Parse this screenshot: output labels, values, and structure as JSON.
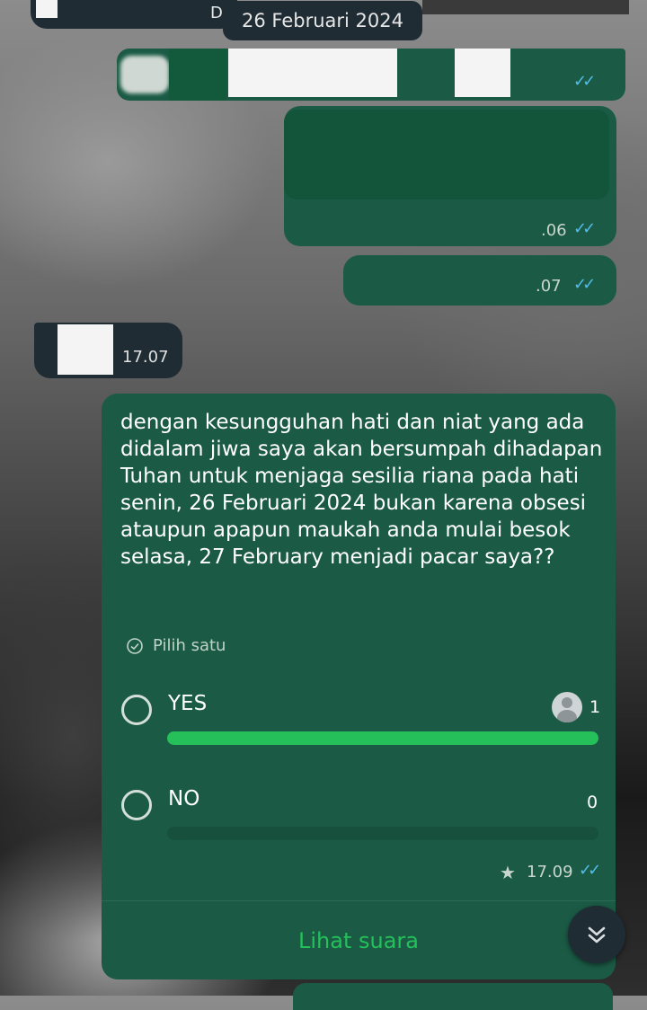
{
  "date_chip": "26 Februari 2024",
  "top_in_fragment": "D",
  "messages": [
    {
      "time": "",
      "status": "read"
    },
    {
      "time": ".06",
      "status": "read"
    },
    {
      "time": ".07",
      "status": "read"
    },
    {
      "time": "17.07",
      "direction": "in"
    }
  ],
  "poll": {
    "question": "dengan kesungguhan hati dan niat yang ada didalam jiwa saya akan bersumpah dihadapan Tuhan untuk menjaga sesilia riana pada hati senin, 26 Februari 2024 bukan karena obsesi ataupun apapun maukah anda mulai besok selasa, 27 February menjadi pacar saya??",
    "hint": "Pilih satu",
    "options": [
      {
        "label": "YES",
        "count": "1",
        "fill": 1.0
      },
      {
        "label": "NO",
        "count": "0",
        "fill": 0.0
      }
    ],
    "time": "17.09",
    "starred": true,
    "view_votes": "Lihat suara"
  },
  "colors": {
    "outgoing": "#1b5b45",
    "incoming": "#1f2c33",
    "accent": "#25c05a",
    "read_ticks": "#53bdeb"
  },
  "icons": [
    "check-circle-icon",
    "star-icon",
    "double-check-icon",
    "avatar-icon",
    "chevron-double-down-icon"
  ]
}
